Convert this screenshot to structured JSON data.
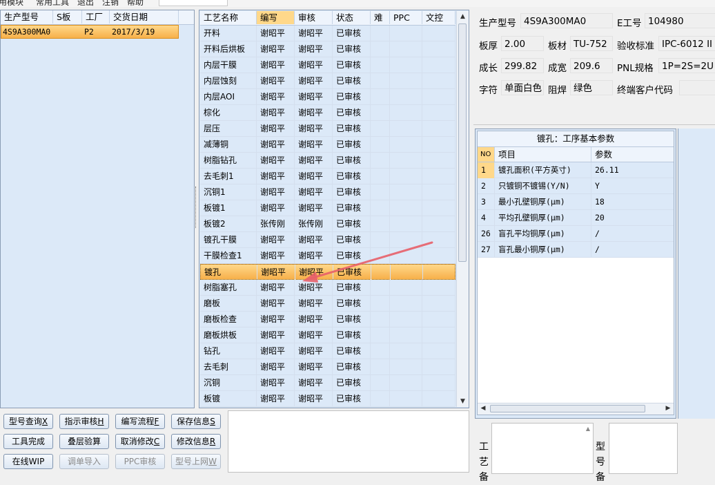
{
  "menu": {
    "items": [
      "用模块",
      "常用工具",
      "退出",
      "注销",
      "帮助"
    ]
  },
  "left_grid": {
    "columns": [
      "生产型号",
      "S板",
      "工厂",
      "交货日期"
    ],
    "rows": [
      {
        "model": "4S9A300MA0",
        "s": "",
        "factory": "P2",
        "date": "2017/3/19"
      }
    ]
  },
  "process_grid": {
    "columns": [
      "工艺名称",
      "编写",
      "审核",
      "状态",
      "难",
      "PPC",
      "文控"
    ],
    "rows": [
      {
        "name": "开料",
        "author": "谢昭平",
        "reviewer": "谢昭平",
        "status": "已审核"
      },
      {
        "name": "开料后烘板",
        "author": "谢昭平",
        "reviewer": "谢昭平",
        "status": "已审核"
      },
      {
        "name": "内层干膜",
        "author": "谢昭平",
        "reviewer": "谢昭平",
        "status": "已审核"
      },
      {
        "name": "内层蚀刻",
        "author": "谢昭平",
        "reviewer": "谢昭平",
        "status": "已审核"
      },
      {
        "name": "内层AOI",
        "author": "谢昭平",
        "reviewer": "谢昭平",
        "status": "已审核"
      },
      {
        "name": "棕化",
        "author": "谢昭平",
        "reviewer": "谢昭平",
        "status": "已审核"
      },
      {
        "name": "层压",
        "author": "谢昭平",
        "reviewer": "谢昭平",
        "status": "已审核"
      },
      {
        "name": "减薄铜",
        "author": "谢昭平",
        "reviewer": "谢昭平",
        "status": "已审核"
      },
      {
        "name": "树脂钻孔",
        "author": "谢昭平",
        "reviewer": "谢昭平",
        "status": "已审核"
      },
      {
        "name": "去毛刺1",
        "author": "谢昭平",
        "reviewer": "谢昭平",
        "status": "已审核"
      },
      {
        "name": "沉铜1",
        "author": "谢昭平",
        "reviewer": "谢昭平",
        "status": "已审核"
      },
      {
        "name": "板镀1",
        "author": "谢昭平",
        "reviewer": "谢昭平",
        "status": "已审核"
      },
      {
        "name": "板镀2",
        "author": "张传刚",
        "reviewer": "张传刚",
        "status": "已审核"
      },
      {
        "name": "镀孔干膜",
        "author": "谢昭平",
        "reviewer": "谢昭平",
        "status": "已审核"
      },
      {
        "name": "干膜检查1",
        "author": "谢昭平",
        "reviewer": "谢昭平",
        "status": "已审核"
      },
      {
        "name": "镀孔",
        "author": "谢昭平",
        "reviewer": "谢昭平",
        "status": "已审核"
      },
      {
        "name": "树脂塞孔",
        "author": "谢昭平",
        "reviewer": "谢昭平",
        "status": "已审核"
      },
      {
        "name": "磨板",
        "author": "谢昭平",
        "reviewer": "谢昭平",
        "status": "已审核"
      },
      {
        "name": "磨板检查",
        "author": "谢昭平",
        "reviewer": "谢昭平",
        "status": "已审核"
      },
      {
        "name": "磨板烘板",
        "author": "谢昭平",
        "reviewer": "谢昭平",
        "status": "已审核"
      },
      {
        "name": "钻孔",
        "author": "谢昭平",
        "reviewer": "谢昭平",
        "status": "已审核"
      },
      {
        "name": "去毛刺",
        "author": "谢昭平",
        "reviewer": "谢昭平",
        "status": "已审核"
      },
      {
        "name": "沉铜",
        "author": "谢昭平",
        "reviewer": "谢昭平",
        "status": "已审核"
      },
      {
        "name": "板镀",
        "author": "谢昭平",
        "reviewer": "谢昭平",
        "status": "已审核"
      }
    ],
    "selected_index": 15
  },
  "info": {
    "model_label": "生产型号",
    "model_value": "4S9A300MA0",
    "eno_label": "E工号",
    "eno_value": "104980",
    "thickness_label": "板厚",
    "thickness_value": "2.00",
    "material_label": "板材",
    "material_value": "TU-752",
    "standard_label": "验收标准",
    "standard_value": "IPC-6012 II",
    "length_label": "成长",
    "length_value": "299.82",
    "width_label": "成宽",
    "width_value": "209.6",
    "pnl_label": "PNL规格",
    "pnl_value": "1P=2S=2U",
    "char_label": "字符",
    "char_value": "单面白色",
    "mask_label": "阻焊",
    "mask_value": "绿色",
    "customer_label": "终端客户代码",
    "customer_value": ""
  },
  "params": {
    "title": "镀孔：工序基本参数",
    "columns": [
      "NO",
      "项目",
      "参数"
    ],
    "rows": [
      {
        "no": "1",
        "item": "镀孔面积(平方英寸)",
        "value": "26.11"
      },
      {
        "no": "2",
        "item": "只镀铜不镀锡(Y/N)",
        "value": "Y"
      },
      {
        "no": "3",
        "item": "最小孔壁铜厚(μm)",
        "value": "18"
      },
      {
        "no": "4",
        "item": "平均孔壁铜厚(μm)",
        "value": "20"
      },
      {
        "no": "26",
        "item": "盲孔平均铜厚(μm)",
        "value": "/"
      },
      {
        "no": "27",
        "item": "盲孔最小铜厚(μm)",
        "value": "/"
      }
    ]
  },
  "buttons": {
    "query": "型号查询",
    "query_key": "X",
    "review": "指示审核",
    "review_key": "H",
    "edit_flow": "编写流程",
    "edit_flow_key": "F",
    "save": "保存信息",
    "save_key": "S",
    "tool_done": "工具完成",
    "stack_check": "叠层验算",
    "cancel_edit": "取消修改",
    "cancel_edit_key": "C",
    "modify": "修改信息",
    "modify_key": "R",
    "online_wip": "在线WIP",
    "import": "调单导入",
    "ppc_review": "PPC审核",
    "upload": "型号上网",
    "upload_key": "W"
  },
  "bottom_right": {
    "process_label": "工艺备",
    "model_label": "型号备"
  },
  "colors": {
    "selection": "#f7b04a",
    "grid_bg": "#dce9f8",
    "arrow": "#e8606a"
  }
}
